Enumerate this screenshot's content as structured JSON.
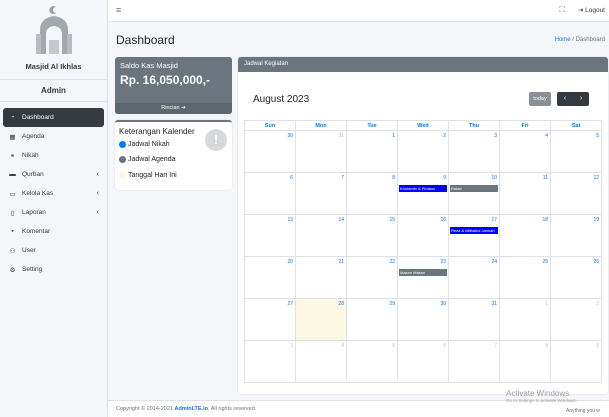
{
  "brand": {
    "name": "Masjid Al Ikhlas"
  },
  "user": {
    "name": "Admin"
  },
  "sidebar": {
    "items": [
      {
        "label": "Dashboard",
        "icon": "dashboard-icon",
        "active": true,
        "has_children": false
      },
      {
        "label": "Agenda",
        "icon": "calendar-icon",
        "active": false,
        "has_children": false
      },
      {
        "label": "Nikah",
        "icon": "couple-icon",
        "active": false,
        "has_children": false
      },
      {
        "label": "Qurban",
        "icon": "box-icon",
        "active": false,
        "has_children": true
      },
      {
        "label": "Kelola Kas",
        "icon": "money-icon",
        "active": false,
        "has_children": true
      },
      {
        "label": "Laporan",
        "icon": "file-icon",
        "active": false,
        "has_children": true
      },
      {
        "label": "Komentar",
        "icon": "comment-icon",
        "active": false,
        "has_children": false
      },
      {
        "label": "User",
        "icon": "users-icon",
        "active": false,
        "has_children": false
      },
      {
        "label": "Setting",
        "icon": "gear-icon",
        "active": false,
        "has_children": false
      }
    ],
    "chevron": "‹"
  },
  "topbar": {
    "menu_glyph": "≡",
    "expand_glyph": "⛶",
    "logout_label": "Logout"
  },
  "header": {
    "title": "Dashboard",
    "breadcrumb_home": "Home",
    "breadcrumb_sep": " / ",
    "breadcrumb_current": "Dashboard"
  },
  "saldo": {
    "label": "Saldo Kas Masjid",
    "value": "Rp. 16,050,000,-",
    "link": "Rincian"
  },
  "keterangan": {
    "title": "Keterangan Kalender",
    "items": [
      {
        "label": "Jadwal Nikah",
        "color": "#007bff"
      },
      {
        "label": "Jadwal Agenda",
        "color": "#6c757d"
      },
      {
        "label": "Tanggal Hari Ini",
        "color": "#fcf8e3"
      }
    ]
  },
  "calendar": {
    "card_title": "Jadwal Kegiatan",
    "month": "August 2023",
    "today_label": "today",
    "prev_glyph": "‹",
    "next_glyph": "›",
    "days": [
      "Sun",
      "Mon",
      "Tue",
      "Wed",
      "Thu",
      "Fri",
      "Sat"
    ],
    "weeks": [
      [
        "30",
        "31",
        "1",
        "2",
        "3",
        "4",
        "5"
      ],
      [
        "6",
        "7",
        "8",
        "9",
        "10",
        "11",
        "12"
      ],
      [
        "13",
        "14",
        "15",
        "16",
        "17",
        "18",
        "19"
      ],
      [
        "20",
        "21",
        "22",
        "23",
        "24",
        "25",
        "26"
      ],
      [
        "27",
        "28",
        "29",
        "30",
        "31",
        "1",
        "2"
      ],
      [
        "3",
        "4",
        "5",
        "6",
        "7",
        "8",
        "9"
      ]
    ],
    "other_month": [
      [
        0,
        1
      ],
      [
        4,
        5
      ],
      [
        4,
        6
      ],
      [
        5,
        0
      ],
      [
        5,
        1
      ],
      [
        5,
        2
      ],
      [
        5,
        3
      ],
      [
        5,
        4
      ],
      [
        5,
        5
      ],
      [
        5,
        6
      ]
    ],
    "today": [
      4,
      1
    ],
    "events": [
      {
        "week": 1,
        "day": 3,
        "title": "Khotamin & Firdaus",
        "type": "nikah"
      },
      {
        "week": 1,
        "day": 4,
        "title": "Ratab",
        "type": "agenda"
      },
      {
        "week": 2,
        "day": 4,
        "title": "Reza & Mifbahul Jannah",
        "type": "nikah"
      },
      {
        "week": 3,
        "day": 3,
        "title": "Makan Makan",
        "type": "agenda"
      }
    ]
  },
  "footer": {
    "prefix": "Copyright © 2014-2021 ",
    "brand": "AdminLTE.io",
    "suffix": ". All rights reserved."
  },
  "watermark": {
    "line1": "Activate Windows",
    "line2": "Go to Settings to activate Windows.",
    "corner": "Anything you w"
  }
}
